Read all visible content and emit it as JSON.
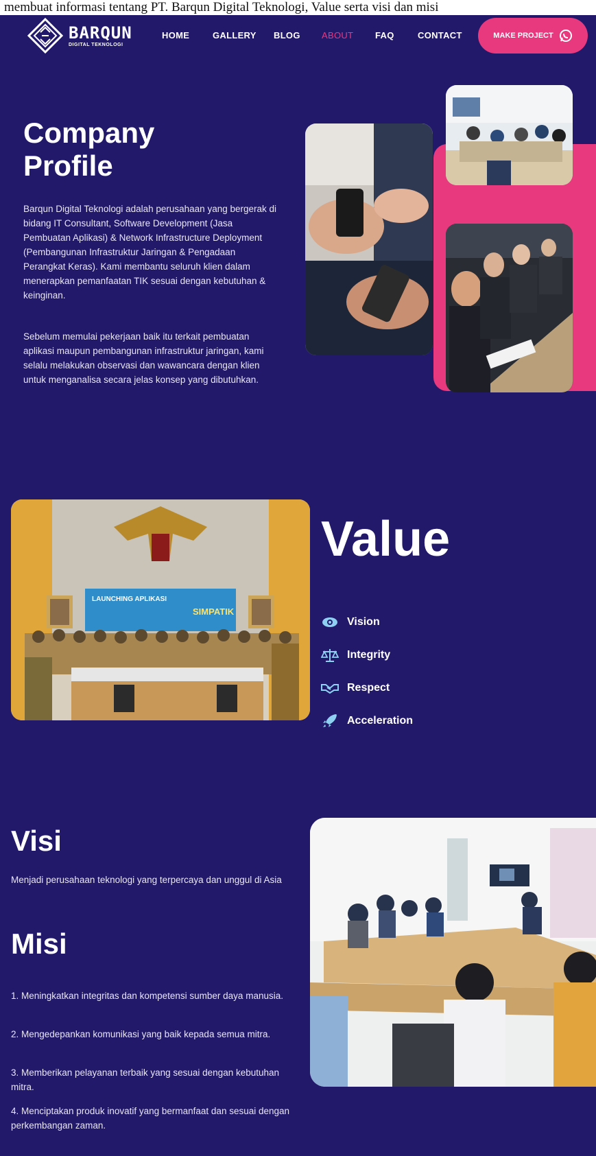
{
  "caption": "membuat informasi tentang PT. Barqun Digital Teknologi, Value serta visi dan misi",
  "brand": {
    "name": "BARQUN",
    "tagline": "DIGITAL TEKNOLOGI",
    "accent_color": "#e8397f",
    "background_color": "#22196b"
  },
  "nav": {
    "items": [
      {
        "label": "HOME",
        "active": false
      },
      {
        "label": "GALLERY",
        "active": false
      },
      {
        "label": "BLOG",
        "active": false
      },
      {
        "label": "ABOUT",
        "active": true
      },
      {
        "label": "FAQ",
        "active": false
      },
      {
        "label": "CONTACT",
        "active": false
      }
    ],
    "cta_label": "MAKE PROJECT",
    "cta_icon": "whatsapp-icon"
  },
  "company": {
    "title": "Company Profile",
    "paragraph_1": "Barqun Digital Teknologi adalah perusahaan yang bergerak di bidang IT Consultant, Software Development (Jasa Pembuatan Aplikasi) & Network Infrastructure Deployment (Pembangunan Infrastruktur Jaringan & Pengadaan Perangkat Keras). Kami membantu seluruh klien dalam menerapkan pemanfaatan TIK sesuai dengan kebutuhan & keinginan.",
    "paragraph_2": "Sebelum memulai pekerjaan baik itu terkait pembuatan aplikasi maupun pembangunan infrastruktur jaringan, kami selalu melakukan observasi dan wawancara dengan klien untuk menganalisa secara jelas konsep yang dibutuhkan."
  },
  "value": {
    "title": "Value",
    "items": [
      {
        "label": "Vision",
        "icon": "eye-icon"
      },
      {
        "label": "Integrity",
        "icon": "scale-icon"
      },
      {
        "label": "Respect",
        "icon": "handshake-icon"
      },
      {
        "label": "Acceleration",
        "icon": "rocket-icon"
      }
    ]
  },
  "visi": {
    "title": "Visi",
    "text": "Menjadi perusahaan teknologi yang terpercaya dan unggul di Asia"
  },
  "misi": {
    "title": "Misi",
    "items": [
      "1. Meningkatkan integritas dan kompetensi sumber daya manusia.",
      "2. Mengedepankan komunikasi yang baik kepada semua mitra.",
      "3. Memberikan pelayanan terbaik yang sesuai dengan kebutuhan mitra.",
      "4. Menciptakan produk inovatif yang bermanfaat dan sesuai dengan perkembangan zaman."
    ]
  },
  "photos": {
    "launch_banner_title": "LAUNCHING APLIKASI",
    "launch_banner_app": "SIMPATIK"
  }
}
